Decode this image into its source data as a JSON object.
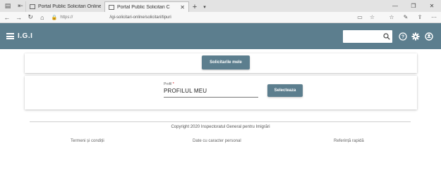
{
  "browser": {
    "tabs": [
      {
        "title": "Portal Public Solicitari Online",
        "active": false
      },
      {
        "title": "Portal Public Solicitari C",
        "active": true
      }
    ],
    "new_tab_label": "+",
    "address": {
      "prefix": "https://",
      "url": "/igi-solicitari-online/solicitari/tipuri"
    }
  },
  "header": {
    "title": "I.G.I",
    "search_placeholder": "",
    "icons": [
      "search-icon",
      "help-icon",
      "gear-icon",
      "account-icon"
    ]
  },
  "main": {
    "my_requests_button": "Solicitarile mele",
    "profile": {
      "label": "Profil",
      "required_mark": "*",
      "value": "PROFILUL MEU"
    },
    "select_button": "Selecteaza"
  },
  "footer": {
    "copyright": "Copyright 2020 Inspectoratul General pentru Imigrări",
    "links": [
      "Termeni și condiții",
      "Date cu caracter personal",
      "Referință rapidă"
    ]
  },
  "colors": {
    "accent": "#5c7e8e",
    "background": "#ffffff"
  }
}
